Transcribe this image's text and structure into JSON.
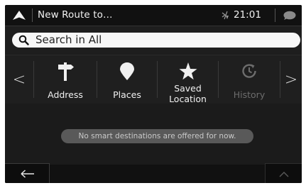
{
  "header": {
    "title": "New Route to…",
    "time": "21:01"
  },
  "search": {
    "label": "Search in All"
  },
  "categories": {
    "prev": "<",
    "next": ">",
    "items": [
      {
        "label": "Address",
        "icon": "signpost-icon",
        "enabled": true
      },
      {
        "label": "Places",
        "icon": "map-pin-icon",
        "enabled": true
      },
      {
        "label": "Saved\nLocation",
        "line1": "Saved",
        "line2": "Location",
        "icon": "star-icon",
        "enabled": true
      },
      {
        "label": "History",
        "icon": "history-clock-icon",
        "enabled": false
      }
    ]
  },
  "main": {
    "message": "No smart destinations are offered for now."
  },
  "colors": {
    "background": "#1b1b1b",
    "text": "#f0f0f0",
    "disabled": "#6d6d6d",
    "message_pill": "#595959"
  }
}
